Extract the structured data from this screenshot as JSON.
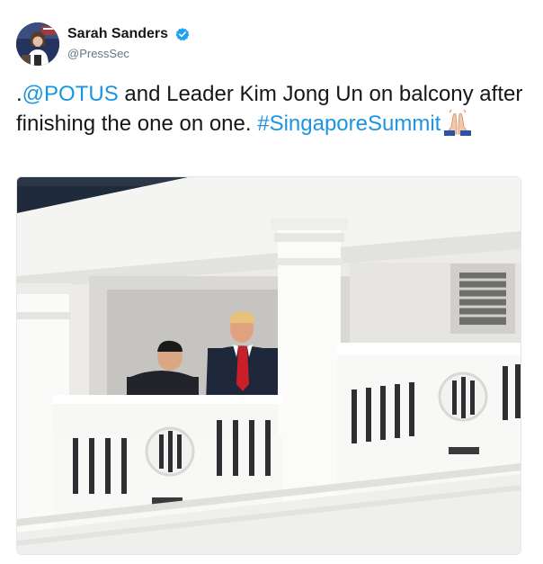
{
  "author": {
    "display_name": "Sarah Sanders",
    "handle": "@PressSec",
    "verified_icon": "verified-badge-icon",
    "verified_color": "#1da1f2"
  },
  "tweet": {
    "prefix": ".",
    "mention": "@POTUS",
    "text_part1": " and Leader Kim Jong Un on balcony after finishing the one on one. ",
    "hashtag": "#SingaporeSummit",
    "emoji": "folded-hands-emoji"
  },
  "colors": {
    "link": "#1b95e0",
    "text": "#14171a",
    "secondary": "#657786"
  },
  "media": {
    "icon": "photo-balcony"
  }
}
